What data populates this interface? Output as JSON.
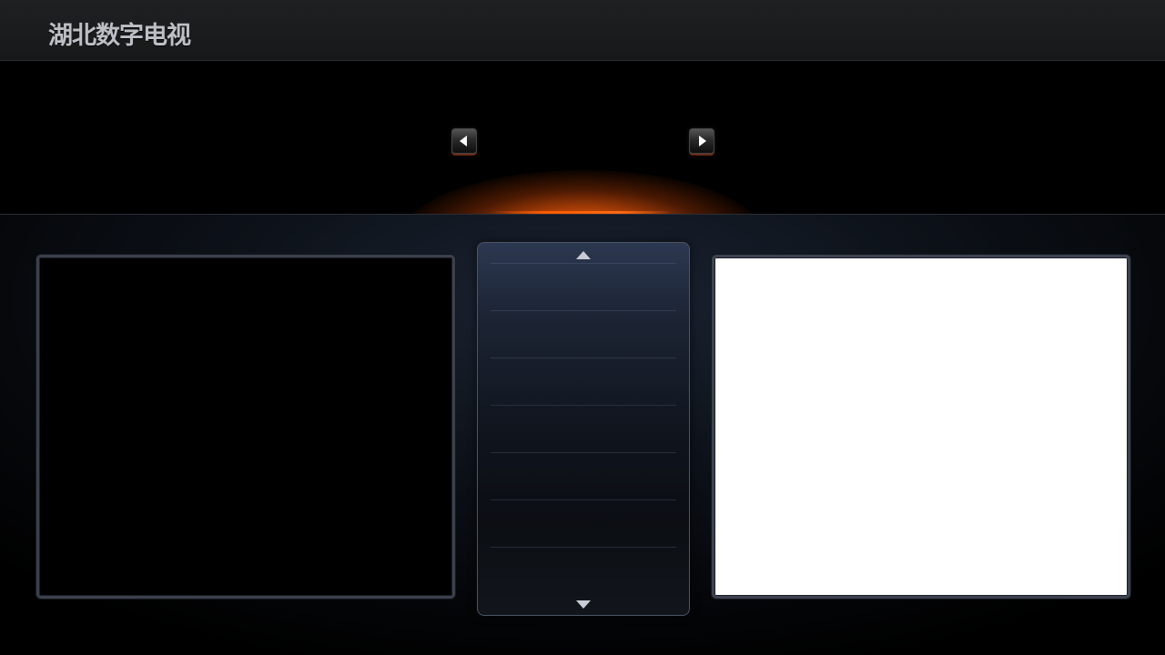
{
  "header": {
    "brand_title": "湖北数字电视"
  },
  "banner": {
    "prev_icon": "triangle-left-icon",
    "next_icon": "triangle-right-icon",
    "accent_color": "#ff6a10"
  },
  "center_list": {
    "scroll_up_icon": "triangle-up-icon",
    "scroll_down_icon": "triangle-down-icon",
    "row_count": 7
  },
  "panels": {
    "left_background": "#000000",
    "right_background": "#ffffff"
  }
}
